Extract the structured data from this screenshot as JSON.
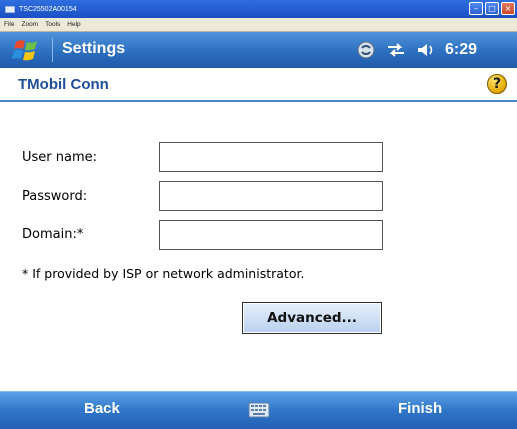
{
  "window": {
    "title": "TSC25502A00154",
    "menu": [
      "File",
      "Zoom",
      "Tools",
      "Help"
    ],
    "minimize_icon": "minimize-icon",
    "maximize_icon": "maximize-icon",
    "close_icon": "close-icon"
  },
  "titlebar": {
    "title": "Settings",
    "time": "6:29",
    "icons": [
      "windows-start-icon",
      "sync-icon",
      "connectivity-icon",
      "volume-icon"
    ]
  },
  "header": {
    "title": "TMobil Conn",
    "help_icon": "help-icon",
    "help_glyph": "?"
  },
  "form": {
    "username_label": "User name:",
    "username_value": "",
    "password_label": "Password:",
    "password_value": "",
    "domain_label": "Domain:*",
    "domain_value": "",
    "note": "* If provided by ISP or network administrator.",
    "advanced_label": "Advanced..."
  },
  "softkeys": {
    "left": "Back",
    "right": "Finish",
    "input_icon": "keyboard-icon"
  },
  "colors": {
    "titlebar": "#2c6fc0",
    "header_text": "#1f4f9a",
    "accent_line": "#4a86cc",
    "help_yellow": "#f0bf10"
  }
}
